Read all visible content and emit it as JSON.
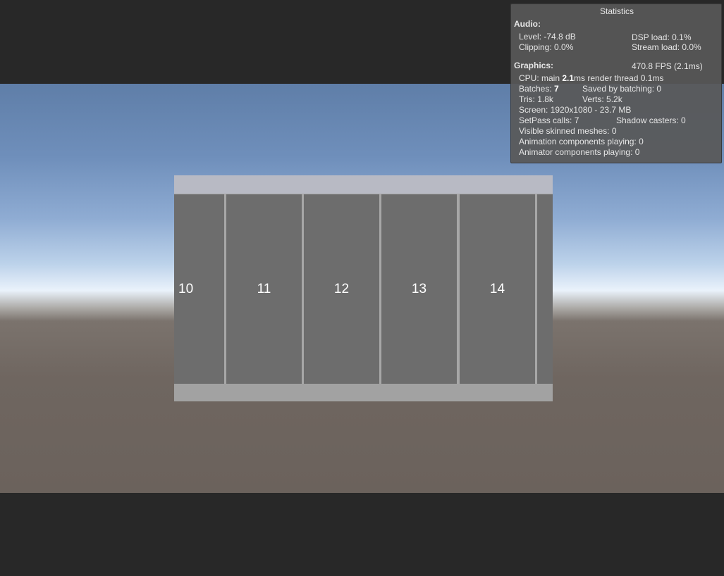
{
  "stats": {
    "title": "Statistics",
    "audio": {
      "heading": "Audio:",
      "level": "Level: -74.8 dB",
      "dsp_load": "DSP load: 0.1%",
      "clipping": "Clipping: 0.0%",
      "stream_load": "Stream load: 0.0%"
    },
    "graphics": {
      "heading": "Graphics:",
      "fps": "470.8 FPS (2.1ms)",
      "cpu_prefix": "CPU: main ",
      "cpu_main_ms": "2.1",
      "cpu_suffix": "ms  render thread 0.1ms",
      "batches_prefix": "Batches: ",
      "batches_value": "7",
      "saved_by_batching": "Saved by batching: 0",
      "tris": "Tris: 1.8k",
      "verts": "Verts: 5.2k",
      "screen": "Screen: 1920x1080 - 23.7 MB",
      "setpass": "SetPass calls: 7",
      "shadow_casters": "Shadow casters: 0",
      "skinned_meshes": "Visible skinned meshes: 0",
      "animation_components": "Animation components playing: 0",
      "animator_components": "Animator components playing: 0"
    }
  },
  "scroll_items": [
    "10",
    "11",
    "12",
    "13",
    "14"
  ]
}
